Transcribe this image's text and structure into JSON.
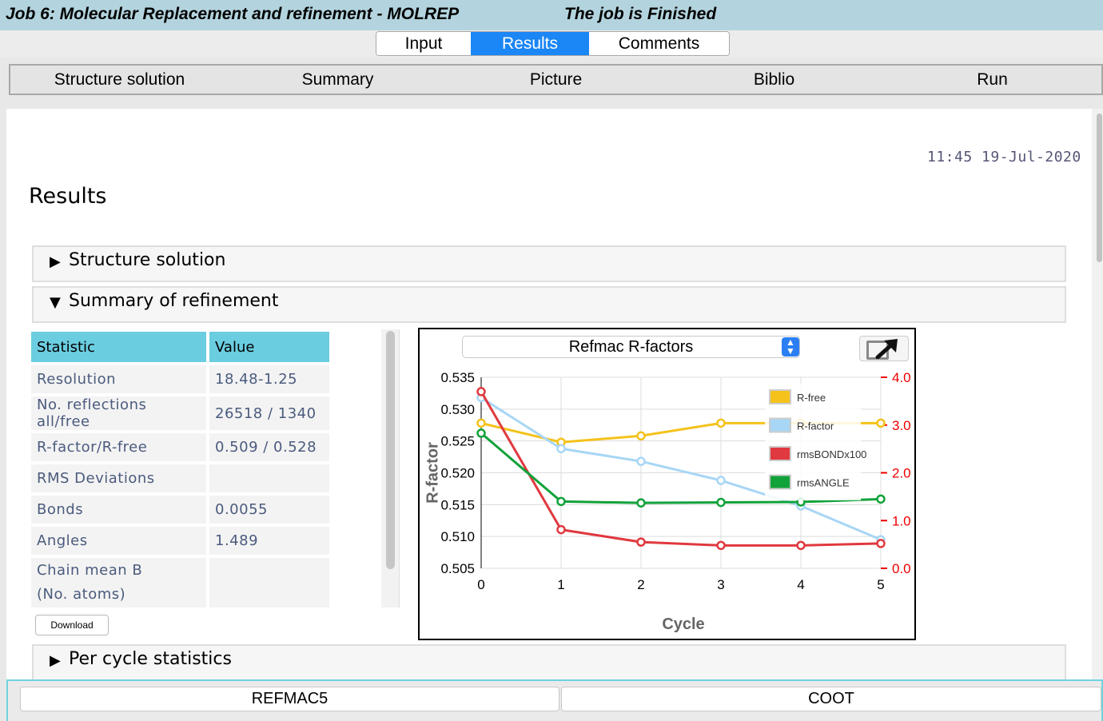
{
  "window": {
    "title": "Job 6:  Molecular Replacement and refinement - MOLREP",
    "status": "The job is Finished"
  },
  "tabs": [
    {
      "label": "Input",
      "selected": false
    },
    {
      "label": "Results",
      "selected": true
    },
    {
      "label": "Comments",
      "selected": false
    }
  ],
  "menu": [
    "Structure solution",
    "Summary",
    "Picture",
    "Biblio",
    "Run"
  ],
  "report": {
    "datetime": "11:45 19-Jul-2020",
    "heading": "Results",
    "sections": [
      {
        "label": "Structure solution",
        "expanded": false
      },
      {
        "label": "Summary of refinement",
        "expanded": true
      },
      {
        "label": "Per cycle statistics",
        "expanded": false
      }
    ],
    "stats_table": {
      "headers": [
        "Statistic",
        "Value"
      ],
      "rows": [
        [
          "Resolution",
          "18.48-1.25"
        ],
        [
          "No. reflections all/free",
          "26518 / 1340"
        ],
        [
          "R-factor/R-free",
          "0.509 / 0.528"
        ],
        [
          "RMS Deviations",
          ""
        ],
        [
          "Bonds",
          "0.0055"
        ],
        [
          "Angles",
          "1.489"
        ],
        [
          "Chain mean B\n(No. atoms)",
          ""
        ]
      ]
    },
    "download_label": "Download"
  },
  "chart_selector": "Refmac R-factors",
  "chart_data": {
    "type": "line",
    "xlabel": "Cycle",
    "ylabel": "R-factor",
    "x": [
      0,
      1,
      2,
      3,
      4,
      5
    ],
    "ylim": [
      0.505,
      0.535
    ],
    "yticks": [
      "0.535",
      "0.530",
      "0.525",
      "0.520",
      "0.515",
      "0.510",
      "0.505"
    ],
    "y2lim": [
      0.0,
      4.0
    ],
    "y2ticks": [
      "4.0",
      "3.0",
      "2.0",
      "1.0",
      "0.0"
    ],
    "legend_position": "top-right",
    "series": [
      {
        "name": "R-free",
        "axis": "left",
        "color": "#f4c21b",
        "values": [
          0.5278,
          0.5248,
          0.5258,
          0.5278,
          0.5278,
          0.5278
        ]
      },
      {
        "name": "R-factor",
        "axis": "left",
        "color": "#a8d6f5",
        "values": [
          0.5318,
          0.5238,
          0.5218,
          0.5188,
          0.5148,
          0.5095
        ]
      },
      {
        "name": "rmsBONDx100",
        "axis": "right",
        "color": "#e0393f",
        "values": [
          3.7,
          0.81,
          0.55,
          0.48,
          0.48,
          0.52
        ]
      },
      {
        "name": "rmsANGLE",
        "axis": "right",
        "color": "#12a23a",
        "values": [
          2.83,
          1.4,
          1.37,
          1.38,
          1.39,
          1.45
        ]
      }
    ]
  },
  "bottom_buttons": [
    "REFMAC5",
    "COOT"
  ]
}
